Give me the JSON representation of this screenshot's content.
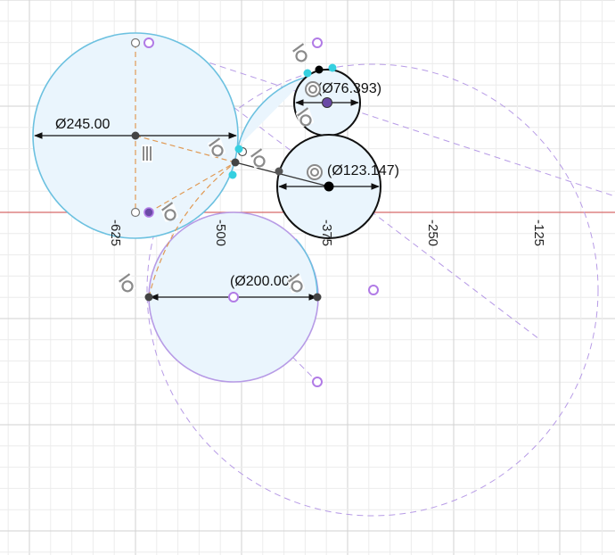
{
  "sketch": {
    "axis_ticks": [
      {
        "label": "-625"
      },
      {
        "label": "-500"
      },
      {
        "label": "-375"
      },
      {
        "label": "-250"
      },
      {
        "label": "-125"
      }
    ],
    "dimensions": {
      "large_circle": "Ø245.00",
      "small_top_circle": "(Ø76.393)",
      "medium_circle": "(Ø123.147)",
      "lower_circle": "(Ø200.00)"
    },
    "colors": {
      "grid": "#e6e6e6",
      "grid_major": "#d2d2d2",
      "axis": "#d66a6a",
      "blue_circle": "#6cc1e0",
      "purple_circle": "#b79be6",
      "fill": "#eaf5fd",
      "construction": "#e09a55",
      "black": "#111111"
    },
    "icons": {
      "tangent": "tangent-constraint-icon",
      "fix": "fix-constraint-icon",
      "concentric": "concentric-constraint-icon"
    }
  }
}
